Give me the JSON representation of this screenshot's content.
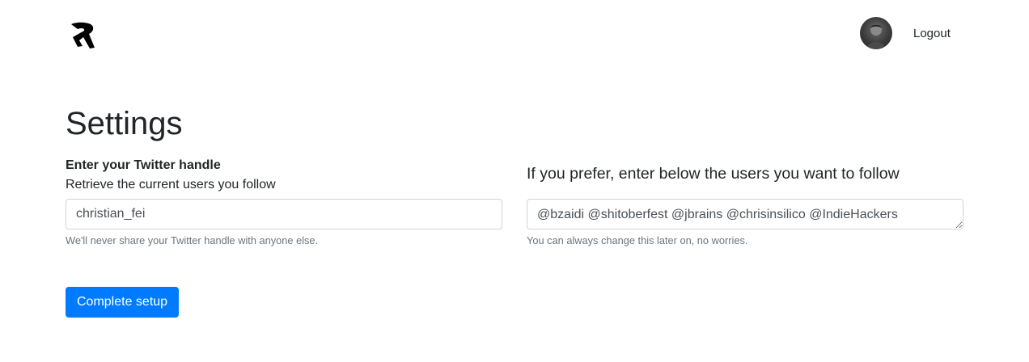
{
  "header": {
    "logo_icon": "brand-logo-icon",
    "avatar_icon": "user-avatar",
    "logout_label": "Logout"
  },
  "page": {
    "title": "Settings"
  },
  "left": {
    "label": "Enter your Twitter handle",
    "sublabel": "Retrieve the current users you follow",
    "input_value": "christian_fei",
    "help": "We'll never share your Twitter handle with anyone else."
  },
  "right": {
    "label": "If you prefer, enter below the users you want to follow",
    "textarea_value": "@bzaidi @shitoberfest @jbrains @chrisinsilico @IndieHackers",
    "help": "You can always change this later on, no worries."
  },
  "actions": {
    "submit_label": "Complete setup"
  },
  "colors": {
    "primary": "#007bff",
    "text": "#212529",
    "muted": "#6c757d",
    "border": "#ced4da"
  }
}
